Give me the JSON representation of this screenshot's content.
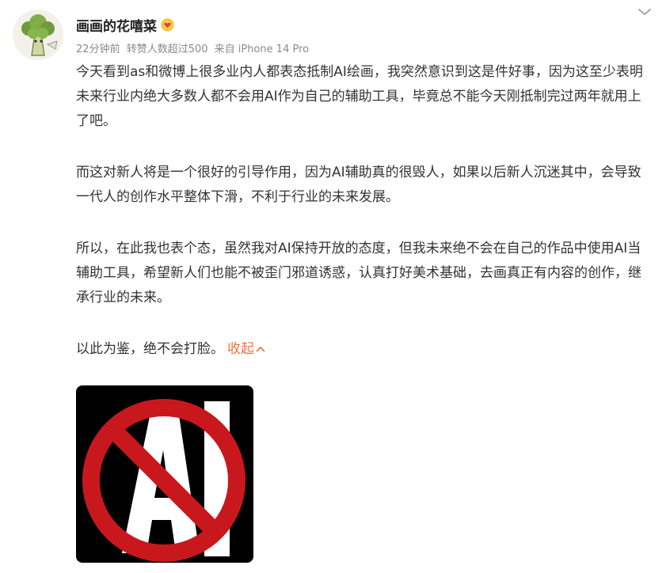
{
  "author": {
    "name": "画画的花嘻菜",
    "badge_icon": "gold-heart-badge-icon"
  },
  "meta": {
    "time": "22分钟前",
    "reposts": "转赞人数超过500",
    "source": "来自 iPhone 14 Pro"
  },
  "post": {
    "paragraphs": [
      "今天看到as和微博上很多业内人都表态抵制AI绘画，我突然意识到这是件好事，因为这至少表明未来行业内绝大多数人都不会用AI作为自己的辅助工具，毕竟总不能今天刚抵制完过两年就用上了吧。",
      "而这对新人将是一个很好的引导作用，因为AI辅助真的很毁人，如果以后新人沉迷其中，会导致一代人的创作水平整体下滑，不利于行业的未来发展。",
      "所以，在此我也表个态，虽然我对AI保持开放的态度，但我未来绝不会在自己的作品中使用AI当辅助工具，希望新人们也能不被歪门邪道诱惑，认真打好美术基础，去画真正有内容的创作，继承行业的未来。",
      "以此为鉴，绝不会打脸。"
    ],
    "collapse_label": "收起"
  },
  "image": {
    "text": "AI",
    "colors": {
      "background": "#000000",
      "ring": "#c8181e",
      "letters": "#ffffff"
    }
  },
  "colors": {
    "link": "#eb7340",
    "meta": "#8a8a8a",
    "text": "#333333"
  }
}
